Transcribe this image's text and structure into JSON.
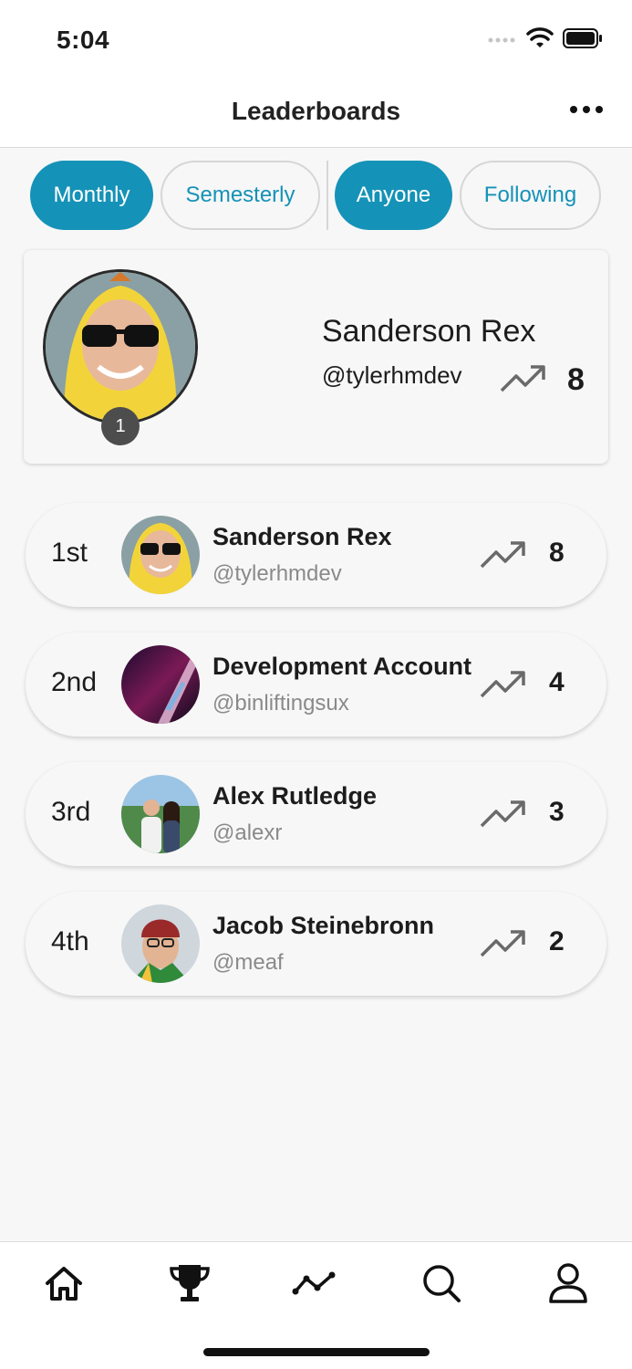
{
  "status_bar": {
    "time": "5:04"
  },
  "header": {
    "title": "Leaderboards",
    "more_icon": "more-horizontal-icon"
  },
  "filters": {
    "period": [
      {
        "label": "Monthly",
        "active": true
      },
      {
        "label": "Semesterly",
        "active": false
      }
    ],
    "audience": [
      {
        "label": "Anyone",
        "active": true
      },
      {
        "label": "Following",
        "active": false
      }
    ]
  },
  "featured": {
    "name": "Sanderson Rex",
    "handle": "@tylerhmdev",
    "rank": "1",
    "score": "8",
    "trend_icon": "trending-up-icon"
  },
  "leaderboard": [
    {
      "rank": "1st",
      "name": "Sanderson Rex",
      "handle": "@tylerhmdev",
      "score": "8"
    },
    {
      "rank": "2nd",
      "name": "Development Account",
      "handle": "@binliftingsux",
      "score": "4"
    },
    {
      "rank": "3rd",
      "name": "Alex Rutledge",
      "handle": "@alexr",
      "score": "3"
    },
    {
      "rank": "4th",
      "name": "Jacob Steinebronn",
      "handle": "@meaf",
      "score": "2"
    }
  ],
  "tabbar": {
    "items": [
      "home-icon",
      "trophy-icon",
      "activity-icon",
      "search-icon",
      "profile-icon"
    ]
  },
  "colors": {
    "accent": "#1592b7",
    "background": "#f7f7f7",
    "badge": "#4d4d4d"
  }
}
